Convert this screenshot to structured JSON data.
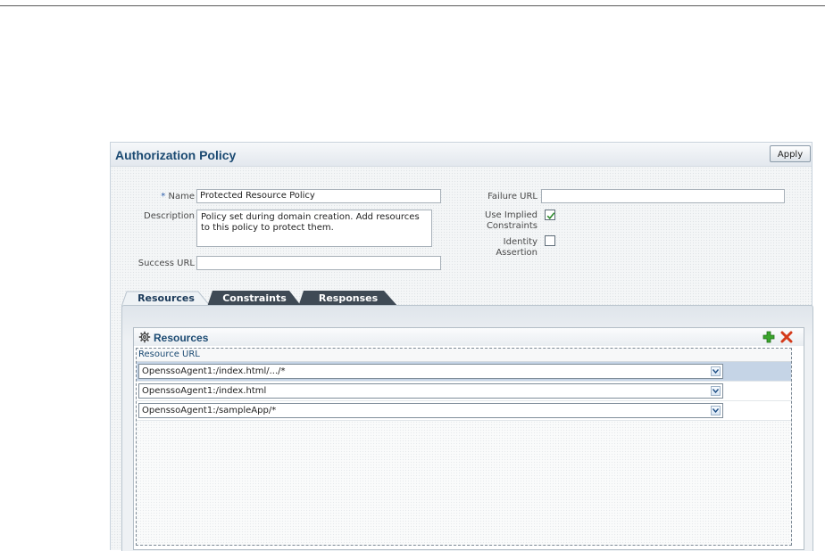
{
  "panel": {
    "title": "Authorization Policy",
    "apply_label": "Apply"
  },
  "form": {
    "name_required_marker": "*",
    "name_label": "Name",
    "name_value": "Protected Resource Policy",
    "description_label": "Description",
    "description_value": "Policy set during domain creation. Add resources to this policy to protect them.",
    "success_url_label": "Success URL",
    "success_url_value": "",
    "failure_url_label": "Failure URL",
    "failure_url_value": "",
    "implied_label_1": "Use Implied",
    "implied_label_2": "Constraints",
    "implied_checked": true,
    "identity_label_1": "Identity",
    "identity_label_2": "Assertion",
    "identity_checked": false
  },
  "tabs": [
    {
      "label": "Resources",
      "active": true
    },
    {
      "label": "Constraints",
      "active": false
    },
    {
      "label": "Responses",
      "active": false
    }
  ],
  "resources": {
    "title": "Resources",
    "column_header": "Resource URL",
    "rows": [
      {
        "value": "OpenssoAgent1:/index.html/.../*",
        "selected": true
      },
      {
        "value": "OpenssoAgent1:/index.html",
        "selected": false
      },
      {
        "value": "OpenssoAgent1:/sampleApp/*",
        "selected": false
      }
    ]
  },
  "icons": {
    "gear": "gear-icon",
    "add": "add-icon",
    "delete": "delete-icon",
    "dropdown": "chevron-down-icon",
    "checkmark": "checkmark-icon"
  },
  "colors": {
    "title_blue": "#1b4a72",
    "tab_dark": "#3f4a55",
    "selected_row": "#c5d4e6",
    "add_green": "#2f9a24",
    "delete_red": "#d43a1a"
  }
}
